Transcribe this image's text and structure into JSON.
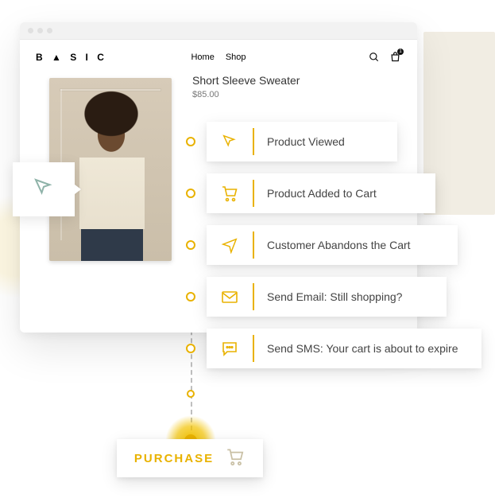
{
  "brand": "B ▲ S I C",
  "nav": {
    "home": "Home",
    "shop": "Shop"
  },
  "cart": {
    "count": "1"
  },
  "product": {
    "title": "Short Sleeve Sweater",
    "price": "$85.00"
  },
  "events": [
    {
      "label": "Product Viewed",
      "icon": "cursor-icon"
    },
    {
      "label": "Product Added to Cart",
      "icon": "cart-icon"
    },
    {
      "label": "Customer Abandons the Cart",
      "icon": "send-icon"
    },
    {
      "label": "Send Email: Still shopping?",
      "icon": "mail-icon"
    },
    {
      "label": "Send SMS: Your cart is about to expire",
      "icon": "sms-icon"
    }
  ],
  "terminal": {
    "label": "PURCHASE",
    "icon": "cart-icon"
  },
  "colors": {
    "accent": "#e9b200",
    "muted_icon": "#c9c0a5"
  }
}
